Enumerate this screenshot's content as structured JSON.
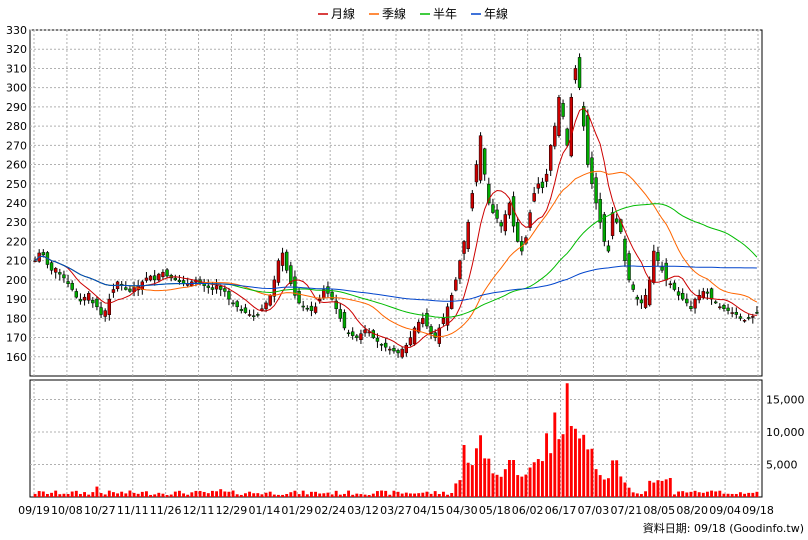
{
  "chart_data": {
    "type": "candlestick",
    "title": "",
    "legend": {
      "placement": "top-center",
      "items": [
        {
          "label": "月線",
          "color": "#cc0000"
        },
        {
          "label": "季線",
          "color": "#ff6600"
        },
        {
          "label": "半年",
          "color": "#00bb00"
        },
        {
          "label": "年線",
          "color": "#0044cc"
        }
      ]
    },
    "price_axis": {
      "min": 150,
      "max": 330,
      "ticks": [
        160,
        170,
        180,
        190,
        200,
        210,
        220,
        230,
        240,
        250,
        260,
        270,
        280,
        290,
        300,
        310,
        320,
        330
      ],
      "side": "left"
    },
    "volume_axis": {
      "min": 0,
      "max": 18000,
      "ticks": [
        5000,
        10000,
        15000
      ],
      "tick_labels": [
        "5,000",
        "10,000",
        "15,000"
      ],
      "side": "right"
    },
    "x_labels": [
      "09/19",
      "10/08",
      "10/27",
      "11/11",
      "11/26",
      "12/11",
      "12/29",
      "01/14",
      "01/29",
      "02/24",
      "03/12",
      "03/27",
      "04/15",
      "04/30",
      "05/18",
      "06/02",
      "06/17",
      "07/03",
      "07/21",
      "08/05",
      "08/20",
      "09/04",
      "09/18"
    ],
    "grid": true,
    "footer_note": "資料日期: 09/18 (Goodinfo.tw)",
    "up_color": "#cc0000",
    "down_color": "#00aa00",
    "volume_color": "#ff0000",
    "close_series": [
      210,
      214,
      213,
      208,
      205,
      206,
      203,
      201,
      198,
      195,
      191,
      189,
      191,
      193,
      188,
      186,
      182,
      184,
      190,
      195,
      199,
      197,
      195,
      194,
      196,
      197,
      199,
      201,
      202,
      200,
      203,
      204,
      202,
      201,
      200,
      199,
      198,
      198,
      199,
      200,
      198,
      197,
      196,
      195,
      197,
      195,
      194,
      190,
      188,
      186,
      184,
      183,
      182,
      181,
      182,
      185,
      188,
      192,
      200,
      210,
      214,
      205,
      198,
      192,
      188,
      186,
      185,
      184,
      186,
      190,
      195,
      193,
      190,
      185,
      180,
      175,
      172,
      171,
      170,
      172,
      174,
      173,
      170,
      168,
      166,
      165,
      164,
      163,
      162,
      164,
      166,
      170,
      175,
      178,
      180,
      176,
      172,
      170,
      175,
      180,
      186,
      192,
      200,
      210,
      220,
      230,
      245,
      260,
      275,
      255,
      240,
      235,
      232,
      228,
      234,
      240,
      228,
      220,
      215,
      222,
      235,
      245,
      250,
      248,
      255,
      270,
      280,
      295,
      285,
      270,
      295,
      310,
      300,
      280,
      260,
      250,
      240,
      230,
      220,
      215,
      235,
      230,
      225,
      210,
      200,
      195,
      190,
      188,
      192,
      200,
      215,
      210,
      205,
      200,
      198,
      195,
      192,
      190,
      188,
      185,
      190,
      192,
      194,
      193,
      190,
      188,
      186,
      185,
      184,
      183,
      182,
      180,
      179,
      180,
      181,
      183
    ]
  }
}
